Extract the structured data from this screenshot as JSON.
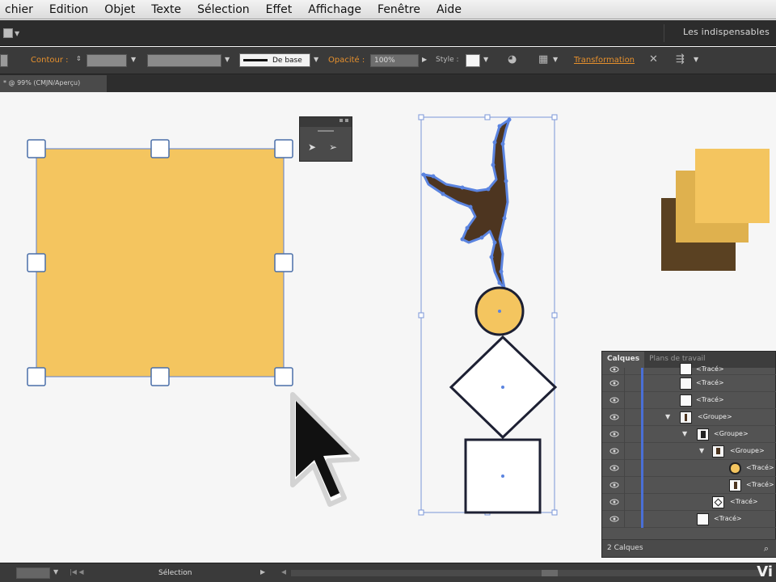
{
  "menu": [
    "chier",
    "Edition",
    "Objet",
    "Texte",
    "Sélection",
    "Effet",
    "Affichage",
    "Fenêtre",
    "Aide"
  ],
  "appbar": {
    "workspace": "Les indispensables"
  },
  "controlbar": {
    "contour_label": "Contour :",
    "stroke_profile": "De base",
    "opacity_label": "Opacité :",
    "opacity_value": "100%",
    "style_label": "Style :",
    "transform_label": "Transformation"
  },
  "doc_tab": {
    "title": "* @ 99% (CMJN/Aperçu)"
  },
  "colors": {
    "shape_fill": "#f4c55f",
    "square_mid": "#dfb14e",
    "square_dark": "#5a4122",
    "figure_brown": "#4d3520",
    "selection_blue": "#4a6fd6",
    "accent_orange": "#e6902d"
  },
  "layers_panel": {
    "tabs": [
      "Calques",
      "Plans de travail"
    ],
    "rows": [
      {
        "name": "<Tracé>",
        "thumb": "white"
      },
      {
        "name": "<Tracé>",
        "thumb": "white"
      },
      {
        "name": "<Tracé>",
        "thumb": "white"
      },
      {
        "name": "<Groupe>",
        "thumb": "figure",
        "expanded": true
      },
      {
        "name": "<Groupe>",
        "thumb": "figure-dark",
        "expanded": true
      },
      {
        "name": "<Groupe>",
        "thumb": "figure-yellow",
        "expanded": true
      },
      {
        "name": "<Tracé>",
        "thumb": "circle"
      },
      {
        "name": "<Tracé>",
        "thumb": "figure-white"
      },
      {
        "name": "<Tracé>",
        "thumb": "diamond"
      },
      {
        "name": "<Tracé>",
        "thumb": "white"
      }
    ],
    "footer": "2 Calques"
  },
  "statusbar": {
    "tool": "Sélection",
    "brand": "Vi"
  }
}
